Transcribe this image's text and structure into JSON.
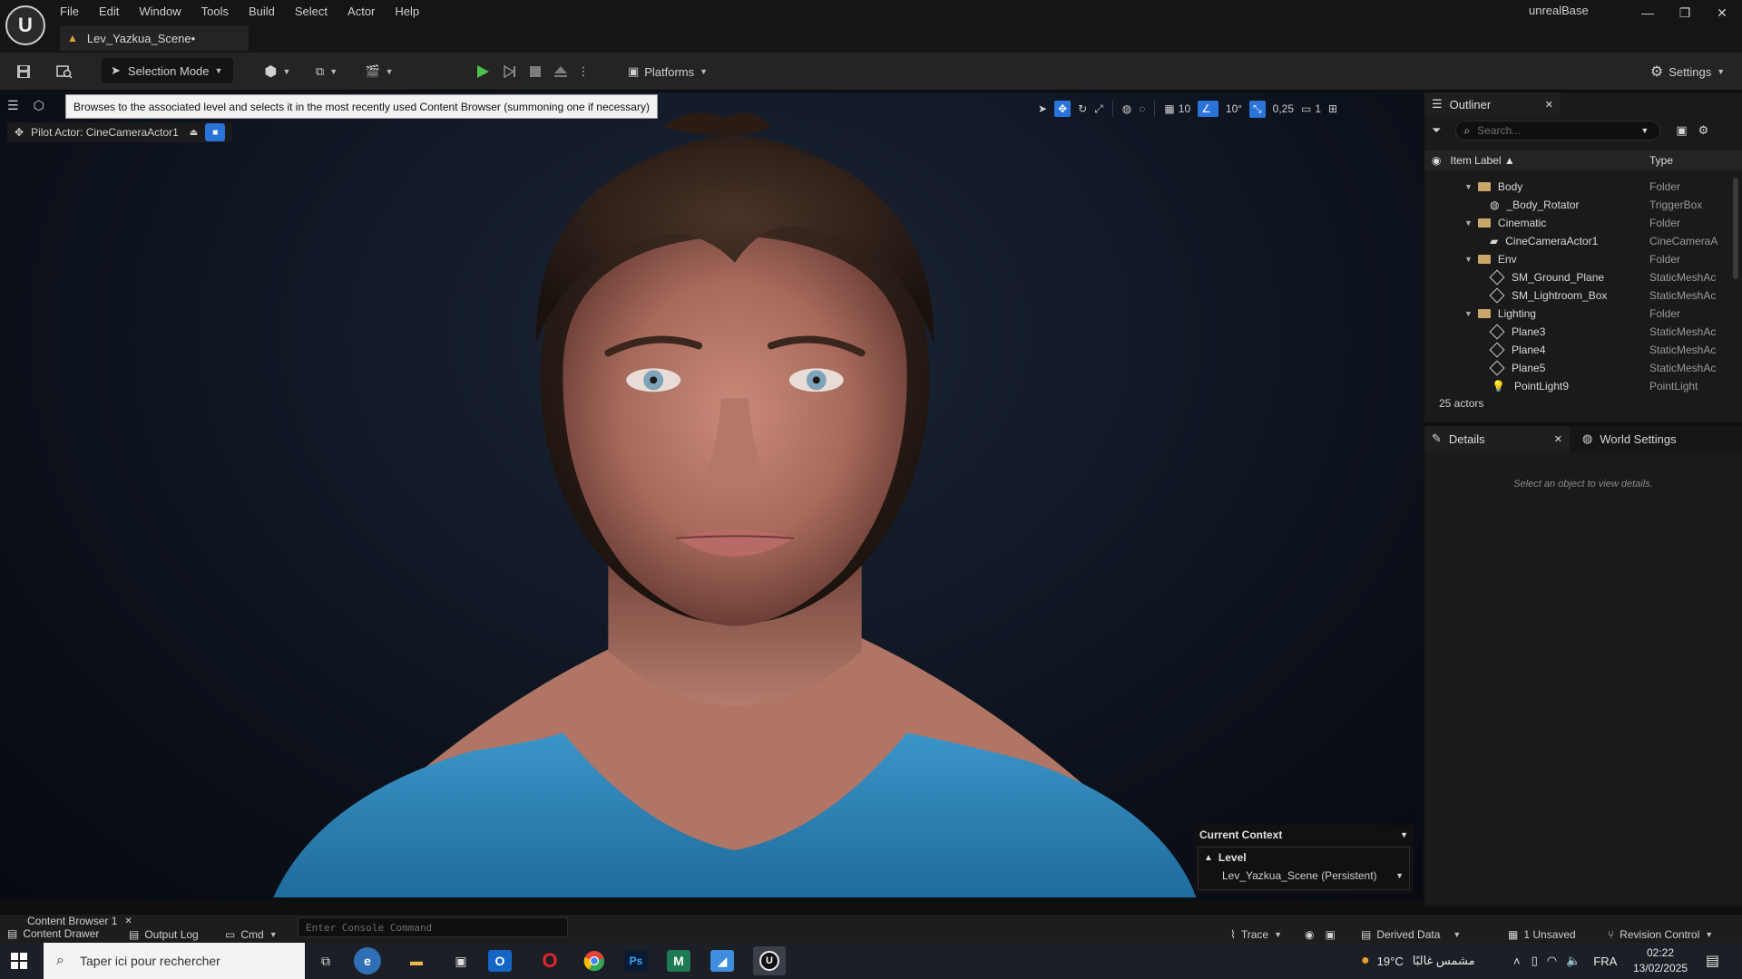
{
  "app": {
    "project_name": "unrealBase",
    "level_tab": "Lev_Yazkua_Scene•",
    "menu": [
      "File",
      "Edit",
      "Window",
      "Tools",
      "Build",
      "Select",
      "Actor",
      "Help"
    ]
  },
  "toolbar": {
    "selection_mode": "Selection Mode",
    "platforms": "Platforms",
    "settings": "Settings"
  },
  "viewport": {
    "tooltip": "Browses to the associated level and selects it in the most recently used Content Browser (summoning one if necessary)",
    "pilot_actor": "Pilot Actor: CineCameraActor1",
    "grid_snap": "10",
    "rotation_snap": "10°",
    "scale_snap": "0,25",
    "camera_speed": "1"
  },
  "current_context": {
    "title": "Current Context",
    "level_label": "Level",
    "level_value": "Lev_Yazkua_Scene (Persistent)"
  },
  "outliner": {
    "tab": "Outliner",
    "search_placeholder": "Search...",
    "col_label": "Item Label ▲",
    "col_type": "Type",
    "rows": [
      {
        "label": "Body",
        "type": "Folder"
      },
      {
        "label": "_Body_Rotator",
        "type": "TriggerBox"
      },
      {
        "label": "Cinematic",
        "type": "Folder"
      },
      {
        "label": "CineCameraActor1",
        "type": "CineCameraA"
      },
      {
        "label": "Env",
        "type": "Folder"
      },
      {
        "label": "SM_Ground_Plane",
        "type": "StaticMeshAc"
      },
      {
        "label": "SM_Lightroom_Box",
        "type": "StaticMeshAc"
      },
      {
        "label": "Lighting",
        "type": "Folder"
      },
      {
        "label": "Plane3",
        "type": "StaticMeshAc"
      },
      {
        "label": "Plane4",
        "type": "StaticMeshAc"
      },
      {
        "label": "Plane5",
        "type": "StaticMeshAc"
      },
      {
        "label": "PointLight9",
        "type": "PointLight"
      }
    ],
    "actor_count": "25 actors"
  },
  "details": {
    "tab": "Details",
    "world_settings_tab": "World Settings",
    "empty_text": "Select an object to view details."
  },
  "status": {
    "content_browser": "Content Browser 1",
    "content_drawer": "Content Drawer",
    "output_log": "Output Log",
    "cmd": "Cmd",
    "console_placeholder": "Enter Console Command",
    "trace": "Trace",
    "derived_data": "Derived Data",
    "unsaved": "1 Unsaved",
    "revision_control": "Revision Control"
  },
  "taskbar": {
    "search_placeholder": "Taper ici pour rechercher",
    "weather": "19°C",
    "weather_text": "مشمس غالبًا",
    "lang": "FRA",
    "time": "02:22",
    "date": "13/02/2025"
  },
  "colors": {
    "accent": "#2a73d8",
    "play_green": "#4cc24c",
    "shirt_blue": "#2f82b8"
  }
}
